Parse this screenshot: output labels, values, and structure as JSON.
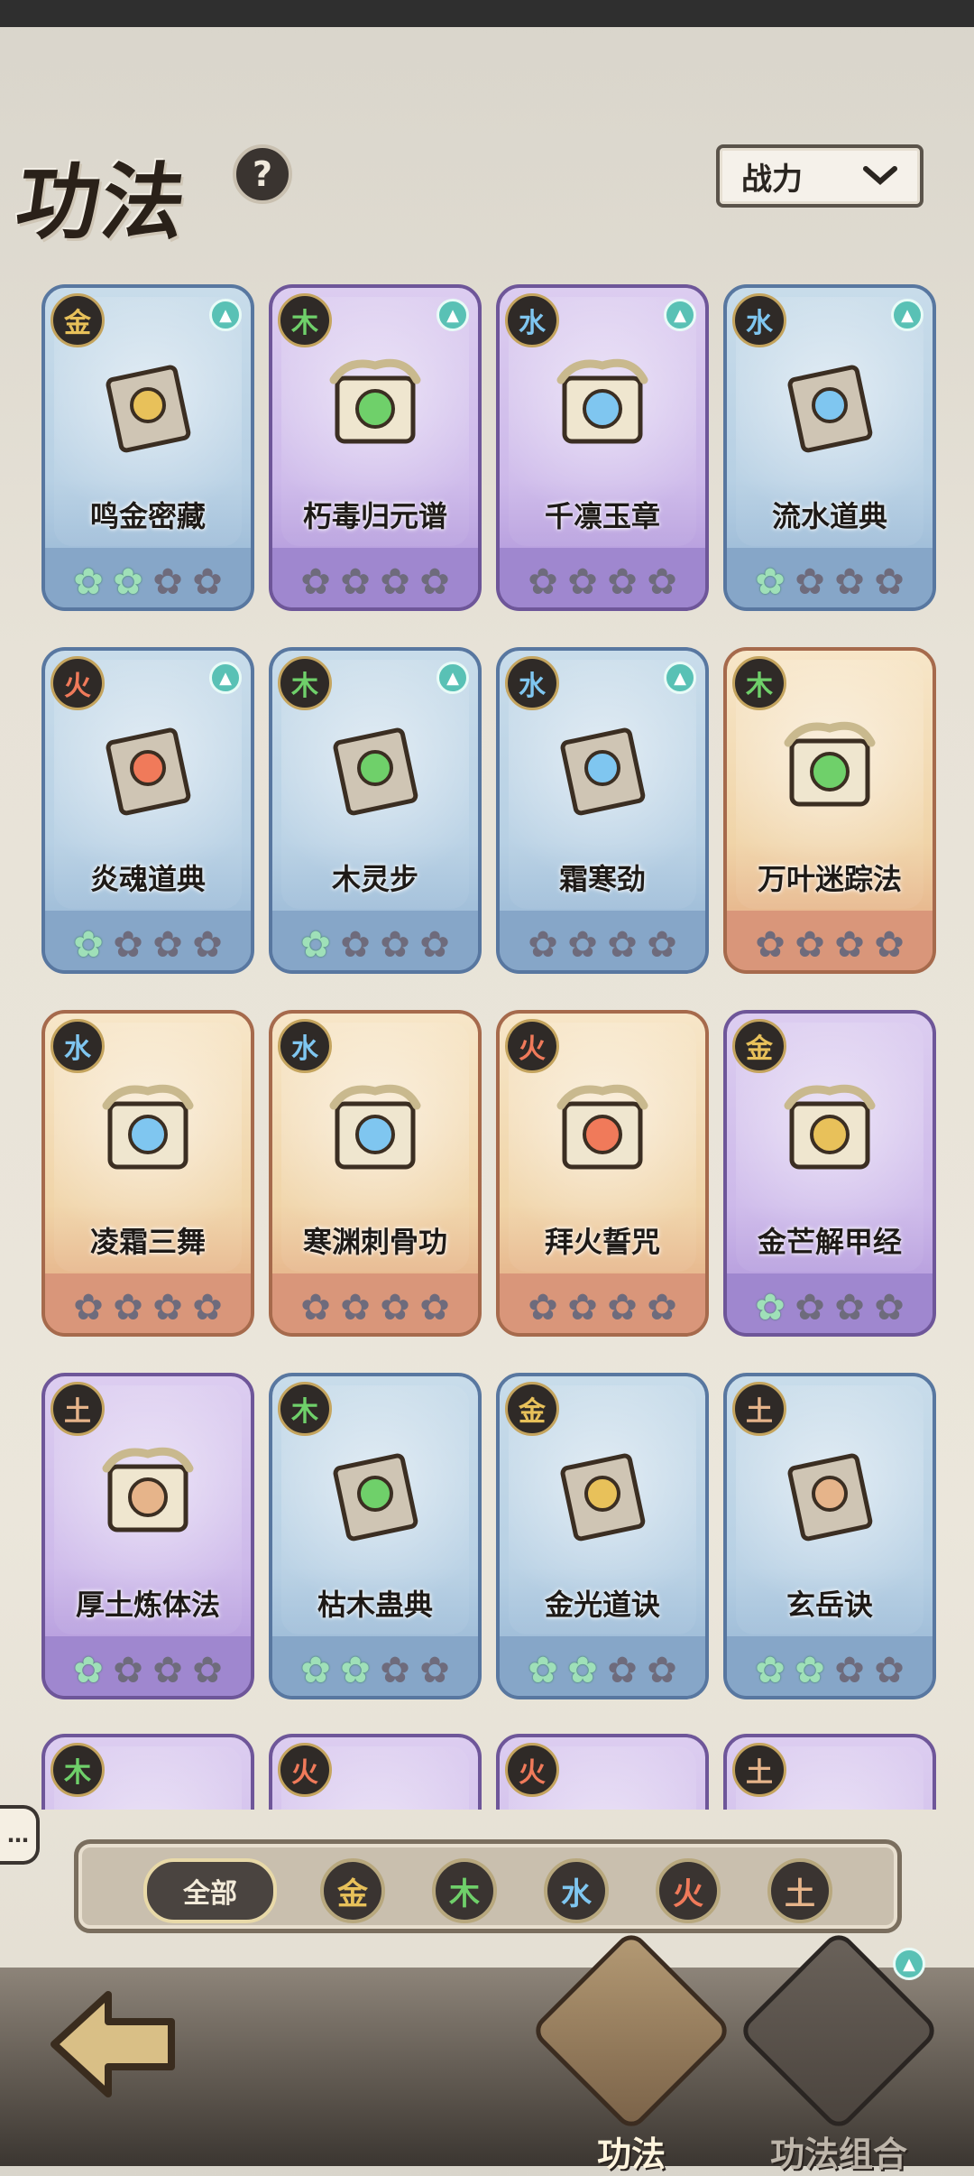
{
  "header": {
    "title": "功法",
    "help": "?"
  },
  "sort": {
    "label": "战力"
  },
  "element_colors": {
    "金": "#e8c15a",
    "木": "#6fd06a",
    "水": "#7fc6f0",
    "火": "#f07a5a",
    "土": "#e6b48a"
  },
  "cards": [
    {
      "name": "鸣金密藏",
      "element": "金",
      "style": "blue",
      "upgrade": true,
      "stars": 2,
      "icon": "book-shield-icon"
    },
    {
      "name": "朽毒归元谱",
      "element": "木",
      "style": "purple",
      "upgrade": true,
      "stars": 0,
      "icon": "dragon-scroll-poison-icon"
    },
    {
      "name": "千凛玉章",
      "element": "水",
      "style": "purple",
      "upgrade": true,
      "stars": 0,
      "icon": "dragon-scroll-ice-icon"
    },
    {
      "name": "流水道典",
      "element": "水",
      "style": "blue",
      "upgrade": true,
      "stars": 1.5,
      "icon": "book-water-icon"
    },
    {
      "name": "炎魂道典",
      "element": "火",
      "style": "blue",
      "upgrade": true,
      "stars": 1.5,
      "icon": "book-fire-icon"
    },
    {
      "name": "木灵步",
      "element": "木",
      "style": "blue",
      "upgrade": true,
      "stars": 1,
      "icon": "book-leaf-icon"
    },
    {
      "name": "霜寒劲",
      "element": "水",
      "style": "blue",
      "upgrade": true,
      "stars": 0,
      "icon": "book-crystal-icon"
    },
    {
      "name": "万叶迷踪法",
      "element": "木",
      "style": "orange",
      "upgrade": false,
      "stars": 0,
      "icon": "dragon-scroll-leaf-icon"
    },
    {
      "name": "凌霜三舞",
      "element": "水",
      "style": "orange",
      "upgrade": false,
      "stars": 0,
      "icon": "dragon-scroll-ice-icon"
    },
    {
      "name": "寒渊刺骨功",
      "element": "水",
      "style": "orange",
      "upgrade": false,
      "stars": 0,
      "icon": "dragon-scroll-crystal-icon"
    },
    {
      "name": "拜火誓咒",
      "element": "火",
      "style": "orange",
      "upgrade": false,
      "stars": 0,
      "icon": "dragon-scroll-fire-icon"
    },
    {
      "name": "金芒解甲经",
      "element": "金",
      "style": "purple",
      "upgrade": false,
      "stars": 1,
      "icon": "dragon-scroll-sword-icon"
    },
    {
      "name": "厚土炼体法",
      "element": "土",
      "style": "purple",
      "upgrade": false,
      "stars": 1,
      "icon": "dragon-scroll-axe-icon"
    },
    {
      "name": "枯木蛊典",
      "element": "木",
      "style": "blue",
      "upgrade": false,
      "stars": 2,
      "icon": "book-poison-icon"
    },
    {
      "name": "金光道诀",
      "element": "金",
      "style": "blue",
      "upgrade": false,
      "stars": 2,
      "icon": "book-star-icon"
    },
    {
      "name": "玄岳诀",
      "element": "土",
      "style": "blue",
      "upgrade": false,
      "stars": 2,
      "icon": "book-axe-icon"
    },
    {
      "name": "",
      "element": "木",
      "style": "purple",
      "upgrade": false,
      "stars": 0,
      "icon": "card-partial"
    },
    {
      "name": "",
      "element": "火",
      "style": "purple",
      "upgrade": false,
      "stars": 0,
      "icon": "card-partial"
    },
    {
      "name": "",
      "element": "火",
      "style": "purple",
      "upgrade": false,
      "stars": 0,
      "icon": "card-partial"
    },
    {
      "name": "",
      "element": "土",
      "style": "purple",
      "upgrade": false,
      "stars": 0,
      "icon": "card-partial"
    }
  ],
  "filters": {
    "all": "全部",
    "elements": [
      "金",
      "木",
      "水",
      "火",
      "土"
    ]
  },
  "nav": {
    "tab1": "功法",
    "tab2": "功法组合"
  }
}
